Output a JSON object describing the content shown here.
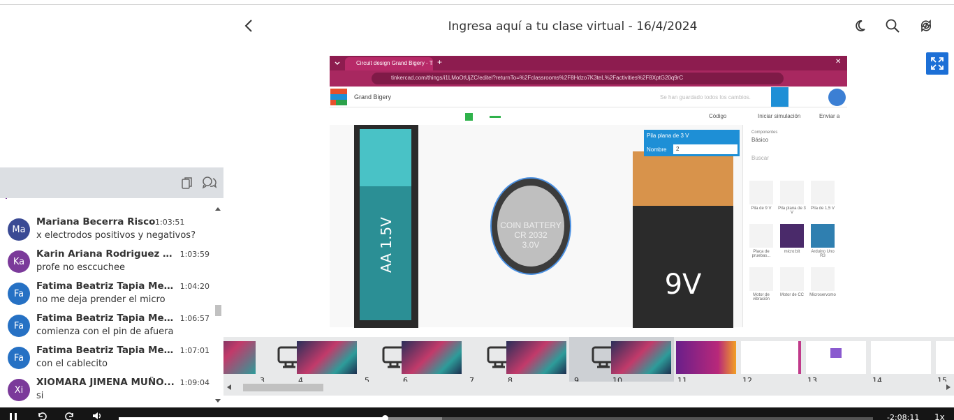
{
  "header": {
    "title": "Ingresa aquí a tu clase virtual - 16/4/2024",
    "icons": [
      "chevron-left-icon",
      "moon-icon",
      "search-icon",
      "refresh-icon",
      "fullscreen-icon"
    ]
  },
  "chat": {
    "header_icons": [
      "copy-icon",
      "chat-icon"
    ],
    "messages": [
      {
        "initials": "Ma",
        "name": "Mariana Becerra Risco",
        "time": "1:03:51",
        "text": "x electrodos positivos y negativos?",
        "color": "#3a4a94"
      },
      {
        "initials": "Ka",
        "name": "Karin Ariana Rodriguez S...",
        "time": "1:03:59",
        "text": "profe no esccuchee",
        "color": "#7b3a9a"
      },
      {
        "initials": "Fa",
        "name": "Fatima Beatriz Tapia Mey...",
        "time": "1:04:20",
        "text": "no me deja prender el micro",
        "color": "#2671c4"
      },
      {
        "initials": "Fa",
        "name": "Fatima Beatriz Tapia Mey...",
        "time": "1:06:57",
        "text": "comienza con el pin de afuera",
        "color": "#2671c4"
      },
      {
        "initials": "Fa",
        "name": "Fatima Beatriz Tapia Mey...",
        "time": "1:07:01",
        "text": "con el cablecito",
        "color": "#2671c4"
      },
      {
        "initials": "Xi",
        "name": "XIOMARA JIMENA MUÑO...",
        "time": "1:09:04",
        "text": "si",
        "color": "#7b3a9a"
      }
    ]
  },
  "screen": {
    "tab_title": "Circuit design Grand Bigery - Ti",
    "url": "tinkercad.com/things/i1LMoOtUjZC/editel?returnTo=%2Fclassrooms%2F8Hdzo7K3teL%2Factivities%2F8XptG20q9rC",
    "design_name": "Grand Bigery",
    "saved_status": "Se han guardado todos los cambios.",
    "btn_code": "Código",
    "btn_simulate": "Iniciar simulación",
    "btn_send": "Enviar a",
    "popup_title": "Pila plana de 3 V",
    "popup_name_label": "Nombre",
    "popup_name_value": "2",
    "components_label": "Componentes",
    "components_value": "Básico",
    "search_placeholder": "Buscar",
    "battery_aa_label": "AA 1.5V",
    "coin_line1": "COIN BATTERY",
    "coin_line2": "CR 2032",
    "coin_line3": "3.0V",
    "battery_9v_label": "9V",
    "components": [
      "Pila de 9 V",
      "Pila plana de 3 V",
      "Pila de 1,5 V",
      "Placa de pruebas...",
      "micro:bit",
      "Arduino Uno R3",
      "Motor de vibración",
      "Motor de CC",
      "Microservomo"
    ]
  },
  "slides": [
    {
      "num": "3",
      "kind": "screen"
    },
    {
      "num": "4",
      "kind": "art"
    },
    {
      "num": "5",
      "kind": "screen"
    },
    {
      "num": "6",
      "kind": "art"
    },
    {
      "num": "7",
      "kind": "screen"
    },
    {
      "num": "8",
      "kind": "art"
    },
    {
      "num": "9",
      "kind": "screen"
    },
    {
      "num": "10",
      "kind": "art"
    },
    {
      "num": "11",
      "kind": "purple"
    },
    {
      "num": "12",
      "kind": "list"
    },
    {
      "num": "13",
      "kind": "question"
    },
    {
      "num": "14",
      "kind": "doc"
    },
    {
      "num": "15",
      "kind": "doc"
    }
  ],
  "player": {
    "progress": 0.3528,
    "time_remaining": "-2:08:11",
    "speed": "1x"
  }
}
